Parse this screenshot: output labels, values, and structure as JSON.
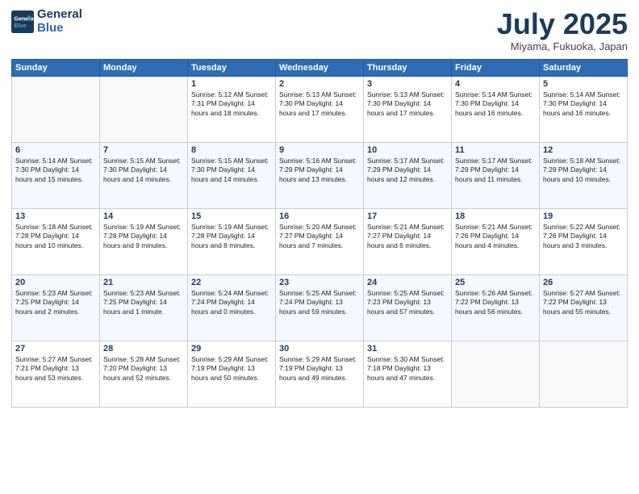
{
  "header": {
    "logo_line1": "General",
    "logo_line2": "Blue",
    "month": "July 2025",
    "location": "Miyama, Fukuoka, Japan"
  },
  "weekdays": [
    "Sunday",
    "Monday",
    "Tuesday",
    "Wednesday",
    "Thursday",
    "Friday",
    "Saturday"
  ],
  "weeks": [
    [
      {
        "day": "",
        "info": ""
      },
      {
        "day": "",
        "info": ""
      },
      {
        "day": "1",
        "info": "Sunrise: 5:12 AM\nSunset: 7:31 PM\nDaylight: 14 hours\nand 18 minutes."
      },
      {
        "day": "2",
        "info": "Sunrise: 5:13 AM\nSunset: 7:30 PM\nDaylight: 14 hours\nand 17 minutes."
      },
      {
        "day": "3",
        "info": "Sunrise: 5:13 AM\nSunset: 7:30 PM\nDaylight: 14 hours\nand 17 minutes."
      },
      {
        "day": "4",
        "info": "Sunrise: 5:14 AM\nSunset: 7:30 PM\nDaylight: 14 hours\nand 16 minutes."
      },
      {
        "day": "5",
        "info": "Sunrise: 5:14 AM\nSunset: 7:30 PM\nDaylight: 14 hours\nand 16 minutes."
      }
    ],
    [
      {
        "day": "6",
        "info": "Sunrise: 5:14 AM\nSunset: 7:30 PM\nDaylight: 14 hours\nand 15 minutes."
      },
      {
        "day": "7",
        "info": "Sunrise: 5:15 AM\nSunset: 7:30 PM\nDaylight: 14 hours\nand 14 minutes."
      },
      {
        "day": "8",
        "info": "Sunrise: 5:15 AM\nSunset: 7:30 PM\nDaylight: 14 hours\nand 14 minutes."
      },
      {
        "day": "9",
        "info": "Sunrise: 5:16 AM\nSunset: 7:29 PM\nDaylight: 14 hours\nand 13 minutes."
      },
      {
        "day": "10",
        "info": "Sunrise: 5:17 AM\nSunset: 7:29 PM\nDaylight: 14 hours\nand 12 minutes."
      },
      {
        "day": "11",
        "info": "Sunrise: 5:17 AM\nSunset: 7:29 PM\nDaylight: 14 hours\nand 11 minutes."
      },
      {
        "day": "12",
        "info": "Sunrise: 5:18 AM\nSunset: 7:29 PM\nDaylight: 14 hours\nand 10 minutes."
      }
    ],
    [
      {
        "day": "13",
        "info": "Sunrise: 5:18 AM\nSunset: 7:28 PM\nDaylight: 14 hours\nand 10 minutes."
      },
      {
        "day": "14",
        "info": "Sunrise: 5:19 AM\nSunset: 7:28 PM\nDaylight: 14 hours\nand 9 minutes."
      },
      {
        "day": "15",
        "info": "Sunrise: 5:19 AM\nSunset: 7:28 PM\nDaylight: 14 hours\nand 8 minutes."
      },
      {
        "day": "16",
        "info": "Sunrise: 5:20 AM\nSunset: 7:27 PM\nDaylight: 14 hours\nand 7 minutes."
      },
      {
        "day": "17",
        "info": "Sunrise: 5:21 AM\nSunset: 7:27 PM\nDaylight: 14 hours\nand 6 minutes."
      },
      {
        "day": "18",
        "info": "Sunrise: 5:21 AM\nSunset: 7:26 PM\nDaylight: 14 hours\nand 4 minutes."
      },
      {
        "day": "19",
        "info": "Sunrise: 5:22 AM\nSunset: 7:26 PM\nDaylight: 14 hours\nand 3 minutes."
      }
    ],
    [
      {
        "day": "20",
        "info": "Sunrise: 5:23 AM\nSunset: 7:25 PM\nDaylight: 14 hours\nand 2 minutes."
      },
      {
        "day": "21",
        "info": "Sunrise: 5:23 AM\nSunset: 7:25 PM\nDaylight: 14 hours\nand 1 minute."
      },
      {
        "day": "22",
        "info": "Sunrise: 5:24 AM\nSunset: 7:24 PM\nDaylight: 14 hours\nand 0 minutes."
      },
      {
        "day": "23",
        "info": "Sunrise: 5:25 AM\nSunset: 7:24 PM\nDaylight: 13 hours\nand 59 minutes."
      },
      {
        "day": "24",
        "info": "Sunrise: 5:25 AM\nSunset: 7:23 PM\nDaylight: 13 hours\nand 57 minutes."
      },
      {
        "day": "25",
        "info": "Sunrise: 5:26 AM\nSunset: 7:22 PM\nDaylight: 13 hours\nand 56 minutes."
      },
      {
        "day": "26",
        "info": "Sunrise: 5:27 AM\nSunset: 7:22 PM\nDaylight: 13 hours\nand 55 minutes."
      }
    ],
    [
      {
        "day": "27",
        "info": "Sunrise: 5:27 AM\nSunset: 7:21 PM\nDaylight: 13 hours\nand 53 minutes."
      },
      {
        "day": "28",
        "info": "Sunrise: 5:28 AM\nSunset: 7:20 PM\nDaylight: 13 hours\nand 52 minutes."
      },
      {
        "day": "29",
        "info": "Sunrise: 5:29 AM\nSunset: 7:19 PM\nDaylight: 13 hours\nand 50 minutes."
      },
      {
        "day": "30",
        "info": "Sunrise: 5:29 AM\nSunset: 7:19 PM\nDaylight: 13 hours\nand 49 minutes."
      },
      {
        "day": "31",
        "info": "Sunrise: 5:30 AM\nSunset: 7:18 PM\nDaylight: 13 hours\nand 47 minutes."
      },
      {
        "day": "",
        "info": ""
      },
      {
        "day": "",
        "info": ""
      }
    ]
  ]
}
